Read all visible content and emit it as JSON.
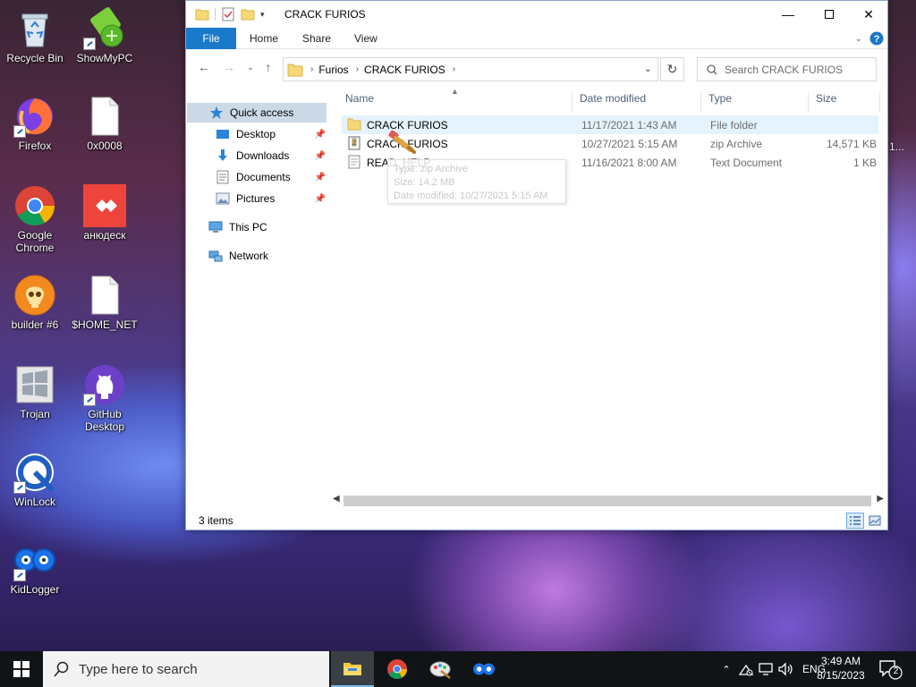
{
  "desktop": {
    "icons": [
      {
        "label": "Recycle Bin"
      },
      {
        "label": "ShowMyPC"
      },
      {
        "label": "Firefox"
      },
      {
        "label": "0x0008"
      },
      {
        "label": "Google Chrome"
      },
      {
        "label": "анюдеск"
      },
      {
        "label": "builder #6"
      },
      {
        "label": "$HOME_NET"
      },
      {
        "label": "Trojan"
      },
      {
        "label": "GitHub Desktop"
      },
      {
        "label": "WinLock"
      },
      {
        "label": "KidLogger"
      }
    ],
    "edge_label": "1..."
  },
  "window": {
    "title": "CRACK FURIOS",
    "ribbon_tabs": [
      "File",
      "Home",
      "Share",
      "View"
    ],
    "breadcrumb": [
      "Furios",
      "CRACK FURIOS"
    ],
    "search_placeholder": "Search CRACK FURIOS",
    "nav": {
      "quick_access": "Quick access",
      "pinned": [
        "Desktop",
        "Downloads",
        "Documents",
        "Pictures"
      ],
      "this_pc": "This PC",
      "network": "Network"
    },
    "columns": [
      "Name",
      "Date modified",
      "Type",
      "Size"
    ],
    "files": [
      {
        "name": "CRACK FURIOS",
        "date": "11/17/2021 1:43 AM",
        "type": "File folder",
        "size": ""
      },
      {
        "name": "CRACK FURIOS",
        "date": "10/27/2021 5:15 AM",
        "type": "zip Archive",
        "size": "14,571 KB"
      },
      {
        "name": "READ_HELP",
        "date": "11/16/2021 8:00 AM",
        "type": "Text Document",
        "size": "1 KB"
      }
    ],
    "tooltip": {
      "type_line": "Type: zip Archive",
      "size_line": "Size: 14.2 MB",
      "date_line": "Date modified: 10/27/2021 5:15 AM"
    },
    "status": "3 items"
  },
  "taskbar": {
    "search_placeholder": "Type here to search",
    "language": "ENG",
    "time": "3:49 AM",
    "date": "8/15/2023",
    "notification_count": "2"
  },
  "colors": {
    "accent": "#1979ca",
    "selection": "#ccd9e6",
    "hover": "#e5f3ff",
    "folder": "#f8d775"
  }
}
